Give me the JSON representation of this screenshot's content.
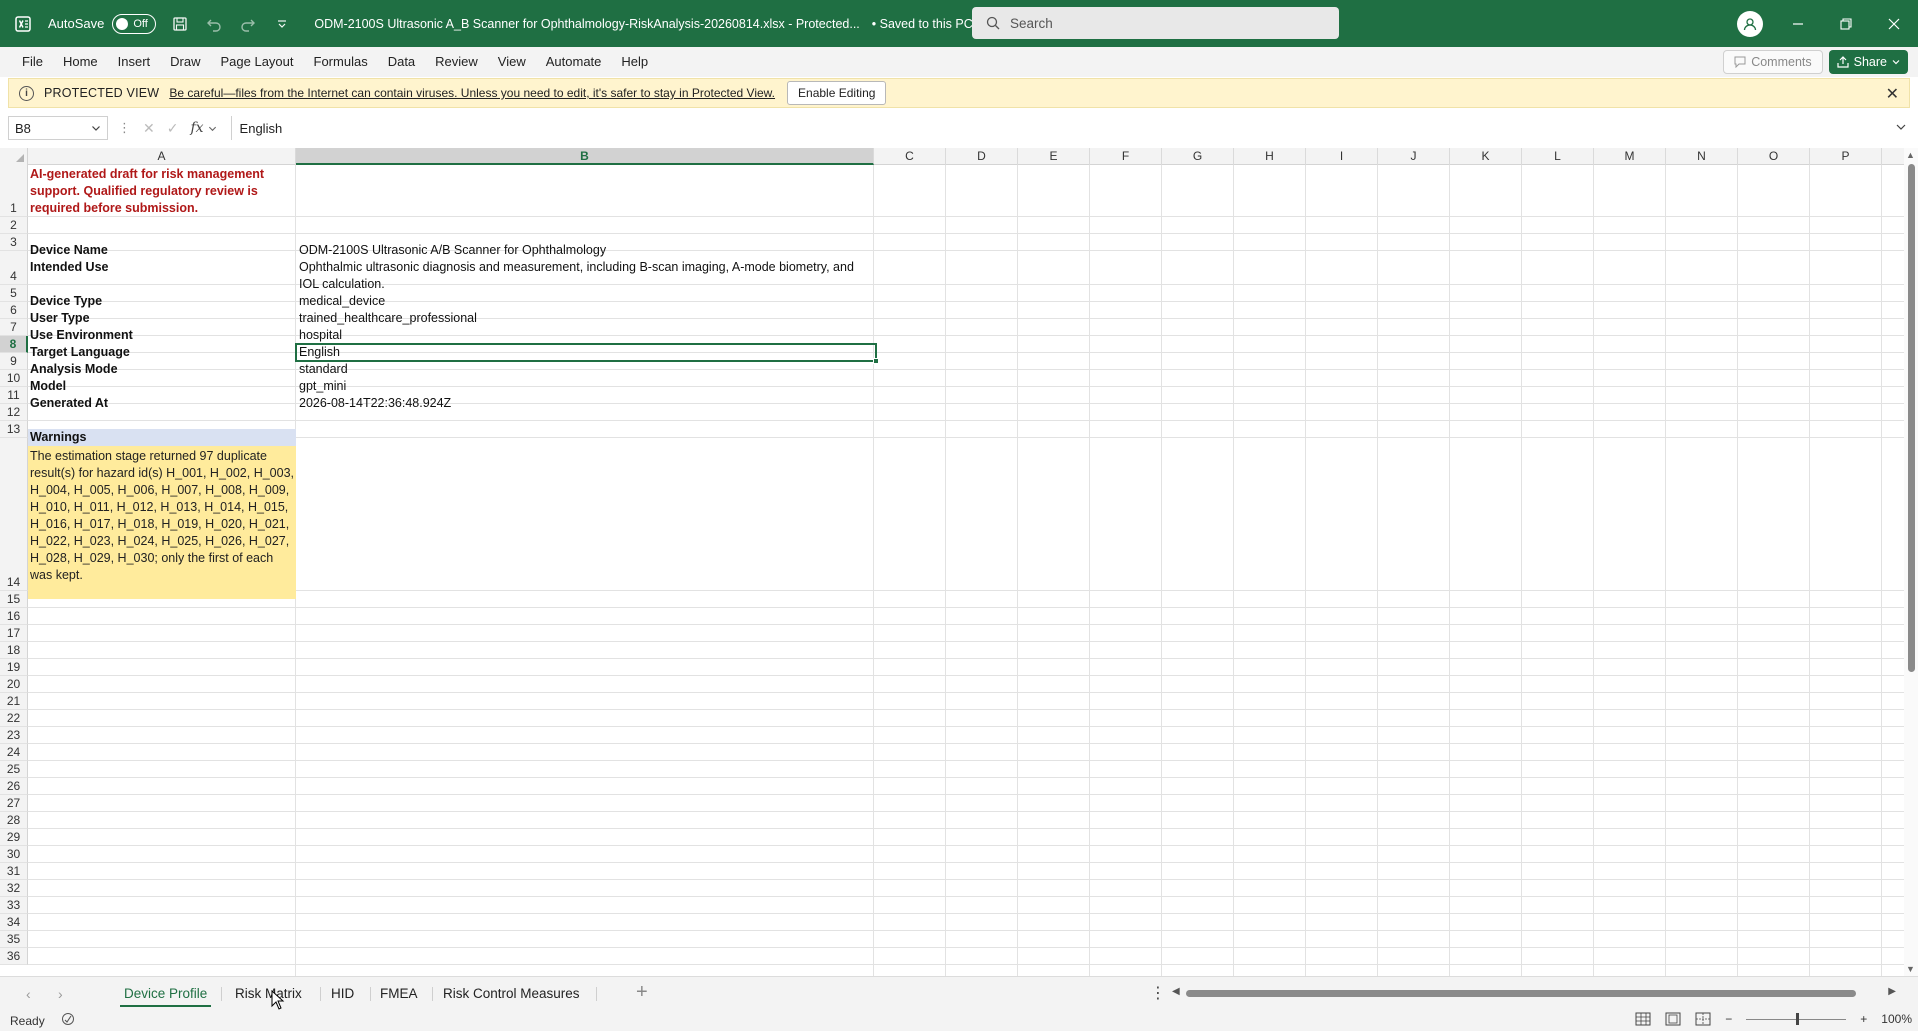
{
  "titlebar": {
    "autosave_label": "AutoSave",
    "autosave_state": "Off",
    "document_title": "ODM-2100S Ultrasonic A_B Scanner for Ophthalmology-RiskAnalysis-20260814.xlsx  -  Protected...",
    "save_status": "• Saved to this PC",
    "search_placeholder": "Search",
    "accent_color": "#1f6f43"
  },
  "menu": {
    "items": [
      "File",
      "Home",
      "Insert",
      "Draw",
      "Page Layout",
      "Formulas",
      "Data",
      "Review",
      "View",
      "Automate",
      "Help"
    ],
    "comments_label": "Comments",
    "share_label": "Share"
  },
  "protected_view": {
    "title": "PROTECTED VIEW",
    "message": "Be careful—files from the Internet can contain viruses. Unless you need to edit, it's safer to stay in Protected View.",
    "enable_label": "Enable Editing"
  },
  "formula_bar": {
    "name_box": "B8",
    "fx_label": "fx",
    "value": "English"
  },
  "grid": {
    "columns": [
      "A",
      "B",
      "C",
      "D",
      "E",
      "F",
      "G",
      "H",
      "I",
      "J",
      "K",
      "L",
      "M",
      "N",
      "O",
      "P"
    ],
    "selected_column": "B",
    "selected_row": "8",
    "rows": [
      "1",
      "2",
      "3",
      "4",
      "5",
      "6",
      "7",
      "8",
      "9",
      "10",
      "11",
      "12",
      "13",
      "14",
      "15",
      "16",
      "17",
      "18",
      "19",
      "20",
      "21",
      "22",
      "23",
      "24",
      "25",
      "26",
      "27",
      "28",
      "29",
      "30",
      "31",
      "32",
      "33",
      "34",
      "35",
      "36"
    ],
    "disclaimer": "AI-generated draft for risk management support. Qualified regulatory review is required before submission.",
    "fields": [
      {
        "label": "Device Name",
        "value": "ODM-2100S Ultrasonic A/B Scanner for Ophthalmology"
      },
      {
        "label": "Intended Use",
        "value": "Ophthalmic ultrasonic diagnosis and measurement, including B-scan imaging, A-mode biometry, and IOL calculation."
      },
      {
        "label": "Device Type",
        "value": "medical_device"
      },
      {
        "label": "User Type",
        "value": "trained_healthcare_professional"
      },
      {
        "label": "Use Environment",
        "value": "hospital"
      },
      {
        "label": "Target Language",
        "value": "English"
      },
      {
        "label": "Analysis Mode",
        "value": "standard"
      },
      {
        "label": "Model",
        "value": "gpt_mini"
      },
      {
        "label": "Generated At",
        "value": "2026-08-14T22:36:48.924Z"
      }
    ],
    "warnings_heading": "Warnings",
    "warnings_text": "The estimation stage returned 97 duplicate result(s) for hazard id(s) H_001, H_002, H_003, H_004, H_005, H_006, H_007, H_008, H_009, H_010, H_011, H_012, H_013, H_014, H_015, H_016, H_017, H_018, H_019, H_020, H_021, H_022, H_023, H_024, H_025, H_026, H_027, H_028, H_029, H_030; only the first of each was kept."
  },
  "sheet_tabs": {
    "tabs": [
      "Device Profile",
      "Risk Matrix",
      "HID",
      "FMEA",
      "Risk Control Measures"
    ],
    "active": "Device Profile"
  },
  "status": {
    "ready": "Ready",
    "zoom": "100%"
  }
}
